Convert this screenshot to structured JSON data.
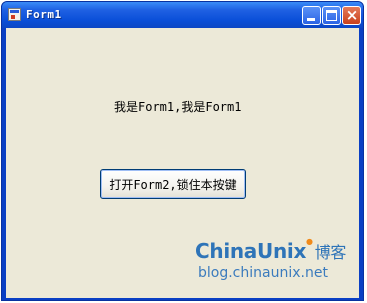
{
  "window": {
    "title": "Form1",
    "controls": {
      "minimize": "minimize",
      "maximize": "maximize",
      "close": "×"
    }
  },
  "form": {
    "label_text": "我是Form1,我是Form1",
    "open_button_label": "打开Form2,锁住本按键"
  },
  "watermark": {
    "logo": "ChinaUnix",
    "logo_mark": "●",
    "logo_cn": "博客",
    "url": "blog.chinaunix.net"
  },
  "colors": {
    "titlebar": "#0a4fd8",
    "client_bg": "#ece9d8",
    "button_border": "#003c74",
    "watermark_blue": "#2e74b8",
    "watermark_orange": "#f08a1a"
  }
}
